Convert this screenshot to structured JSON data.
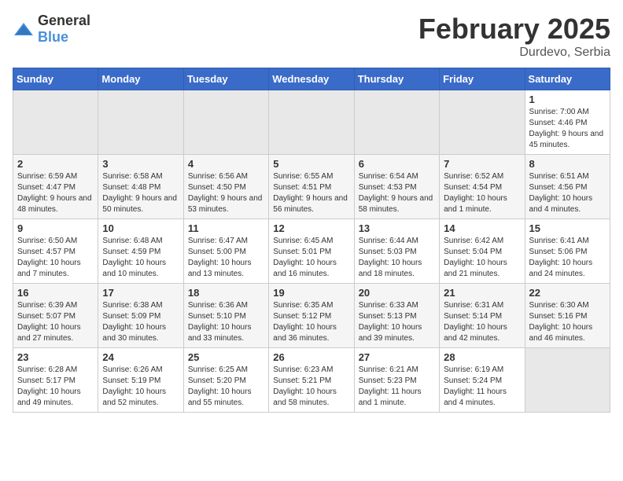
{
  "header": {
    "logo_general": "General",
    "logo_blue": "Blue",
    "month_year": "February 2025",
    "location": "Durdevo, Serbia"
  },
  "days_of_week": [
    "Sunday",
    "Monday",
    "Tuesday",
    "Wednesday",
    "Thursday",
    "Friday",
    "Saturday"
  ],
  "weeks": [
    [
      {
        "day": "",
        "info": ""
      },
      {
        "day": "",
        "info": ""
      },
      {
        "day": "",
        "info": ""
      },
      {
        "day": "",
        "info": ""
      },
      {
        "day": "",
        "info": ""
      },
      {
        "day": "",
        "info": ""
      },
      {
        "day": "1",
        "info": "Sunrise: 7:00 AM\nSunset: 4:46 PM\nDaylight: 9 hours and 45 minutes."
      }
    ],
    [
      {
        "day": "2",
        "info": "Sunrise: 6:59 AM\nSunset: 4:47 PM\nDaylight: 9 hours and 48 minutes."
      },
      {
        "day": "3",
        "info": "Sunrise: 6:58 AM\nSunset: 4:48 PM\nDaylight: 9 hours and 50 minutes."
      },
      {
        "day": "4",
        "info": "Sunrise: 6:56 AM\nSunset: 4:50 PM\nDaylight: 9 hours and 53 minutes."
      },
      {
        "day": "5",
        "info": "Sunrise: 6:55 AM\nSunset: 4:51 PM\nDaylight: 9 hours and 56 minutes."
      },
      {
        "day": "6",
        "info": "Sunrise: 6:54 AM\nSunset: 4:53 PM\nDaylight: 9 hours and 58 minutes."
      },
      {
        "day": "7",
        "info": "Sunrise: 6:52 AM\nSunset: 4:54 PM\nDaylight: 10 hours and 1 minute."
      },
      {
        "day": "8",
        "info": "Sunrise: 6:51 AM\nSunset: 4:56 PM\nDaylight: 10 hours and 4 minutes."
      }
    ],
    [
      {
        "day": "9",
        "info": "Sunrise: 6:50 AM\nSunset: 4:57 PM\nDaylight: 10 hours and 7 minutes."
      },
      {
        "day": "10",
        "info": "Sunrise: 6:48 AM\nSunset: 4:59 PM\nDaylight: 10 hours and 10 minutes."
      },
      {
        "day": "11",
        "info": "Sunrise: 6:47 AM\nSunset: 5:00 PM\nDaylight: 10 hours and 13 minutes."
      },
      {
        "day": "12",
        "info": "Sunrise: 6:45 AM\nSunset: 5:01 PM\nDaylight: 10 hours and 16 minutes."
      },
      {
        "day": "13",
        "info": "Sunrise: 6:44 AM\nSunset: 5:03 PM\nDaylight: 10 hours and 18 minutes."
      },
      {
        "day": "14",
        "info": "Sunrise: 6:42 AM\nSunset: 5:04 PM\nDaylight: 10 hours and 21 minutes."
      },
      {
        "day": "15",
        "info": "Sunrise: 6:41 AM\nSunset: 5:06 PM\nDaylight: 10 hours and 24 minutes."
      }
    ],
    [
      {
        "day": "16",
        "info": "Sunrise: 6:39 AM\nSunset: 5:07 PM\nDaylight: 10 hours and 27 minutes."
      },
      {
        "day": "17",
        "info": "Sunrise: 6:38 AM\nSunset: 5:09 PM\nDaylight: 10 hours and 30 minutes."
      },
      {
        "day": "18",
        "info": "Sunrise: 6:36 AM\nSunset: 5:10 PM\nDaylight: 10 hours and 33 minutes."
      },
      {
        "day": "19",
        "info": "Sunrise: 6:35 AM\nSunset: 5:12 PM\nDaylight: 10 hours and 36 minutes."
      },
      {
        "day": "20",
        "info": "Sunrise: 6:33 AM\nSunset: 5:13 PM\nDaylight: 10 hours and 39 minutes."
      },
      {
        "day": "21",
        "info": "Sunrise: 6:31 AM\nSunset: 5:14 PM\nDaylight: 10 hours and 42 minutes."
      },
      {
        "day": "22",
        "info": "Sunrise: 6:30 AM\nSunset: 5:16 PM\nDaylight: 10 hours and 46 minutes."
      }
    ],
    [
      {
        "day": "23",
        "info": "Sunrise: 6:28 AM\nSunset: 5:17 PM\nDaylight: 10 hours and 49 minutes."
      },
      {
        "day": "24",
        "info": "Sunrise: 6:26 AM\nSunset: 5:19 PM\nDaylight: 10 hours and 52 minutes."
      },
      {
        "day": "25",
        "info": "Sunrise: 6:25 AM\nSunset: 5:20 PM\nDaylight: 10 hours and 55 minutes."
      },
      {
        "day": "26",
        "info": "Sunrise: 6:23 AM\nSunset: 5:21 PM\nDaylight: 10 hours and 58 minutes."
      },
      {
        "day": "27",
        "info": "Sunrise: 6:21 AM\nSunset: 5:23 PM\nDaylight: 11 hours and 1 minute."
      },
      {
        "day": "28",
        "info": "Sunrise: 6:19 AM\nSunset: 5:24 PM\nDaylight: 11 hours and 4 minutes."
      },
      {
        "day": "",
        "info": ""
      }
    ]
  ]
}
